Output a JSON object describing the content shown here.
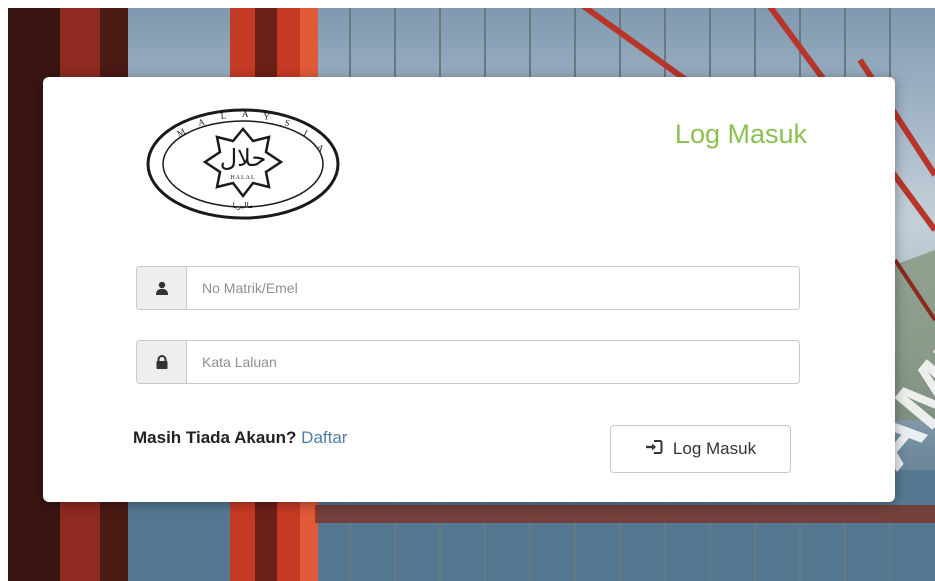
{
  "form": {
    "title": "Log Masuk",
    "username": {
      "placeholder": "No Matrik/Emel",
      "value": "",
      "icon": "user-icon"
    },
    "password": {
      "placeholder": "Kata Laluan",
      "value": "",
      "icon": "lock-icon"
    },
    "register_prompt": "Masih Tiada Akaun?",
    "register_link": "Daftar",
    "submit_label": "Log Masuk",
    "submit_icon": "sign-in-icon"
  },
  "logo": {
    "label": "HALAL",
    "arabic": "حلال",
    "ring_text": "MALAYSIA"
  },
  "colors": {
    "title": "#8cc152",
    "link": "#4e7ea5",
    "bridge": "#c0392b"
  },
  "watermark": "SAMPLE"
}
